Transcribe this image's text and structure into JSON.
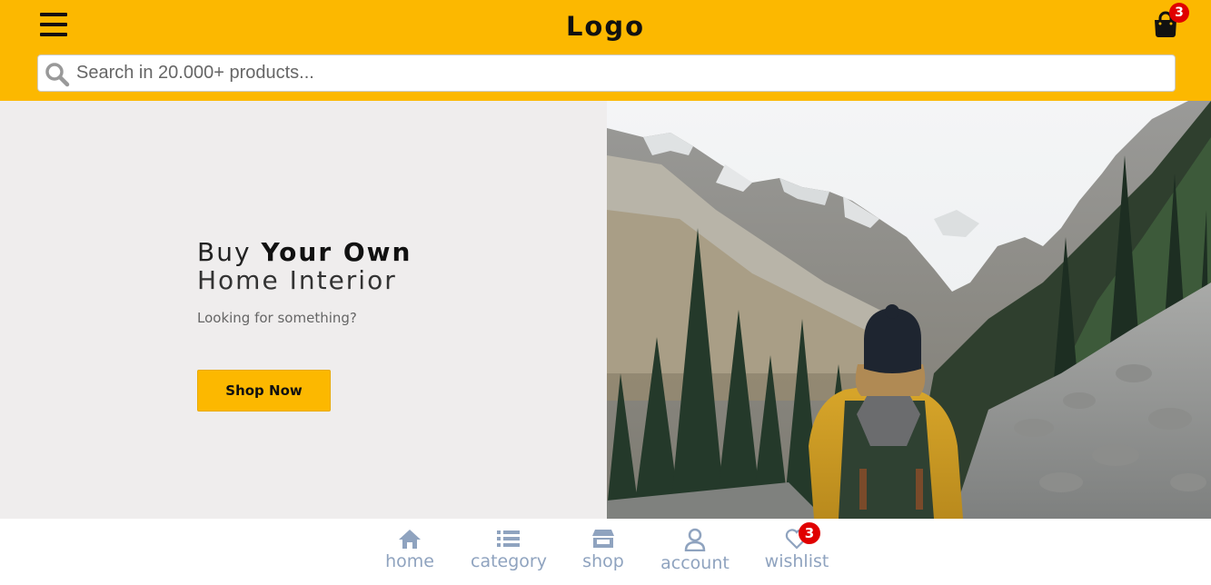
{
  "header": {
    "menu_icon": "hamburger-menu-icon",
    "logo": "Logo",
    "cart_icon": "shopping-bag-icon",
    "cart_count": "3"
  },
  "search": {
    "icon": "search-icon",
    "placeholder": "Search in 20.000+ products..."
  },
  "hero": {
    "title_light": "Buy ",
    "title_bold": "Your Own",
    "title_line2": "Home Interior",
    "subtitle": "Looking for something?",
    "button_label": "Shop Now",
    "image_alt": "Hiker with yellow jacket and backpack looking at mountain valley with pine forest"
  },
  "bottom_nav": {
    "items": [
      {
        "label": "home",
        "icon": "home-icon"
      },
      {
        "label": "category",
        "icon": "list-icon"
      },
      {
        "label": "shop",
        "icon": "store-icon"
      },
      {
        "label": "account",
        "icon": "user-icon"
      },
      {
        "label": "wishlist",
        "icon": "heart-icon",
        "badge": "3"
      }
    ]
  },
  "colors": {
    "brand_yellow": "#fcb800",
    "badge_red": "#e00000",
    "nav_gray": "#8fa3bf",
    "hero_bg": "#efeded"
  }
}
